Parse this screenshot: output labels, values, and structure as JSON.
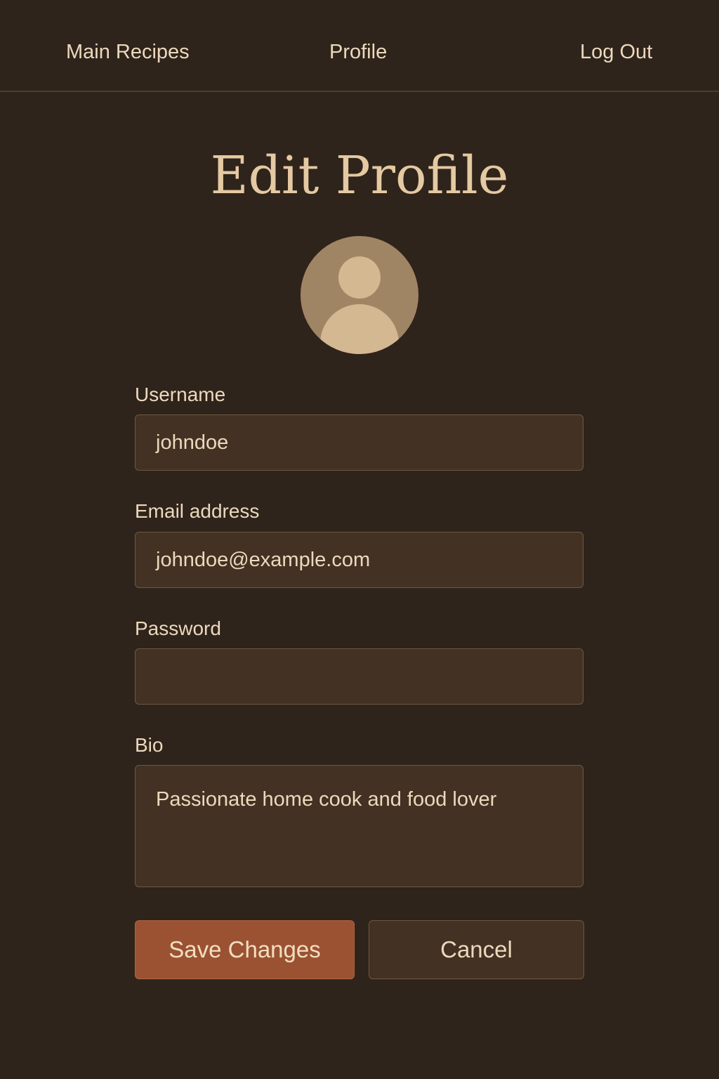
{
  "nav": {
    "items": [
      {
        "label": "Main Recipes"
      },
      {
        "label": "Profile"
      },
      {
        "label": "Log Out"
      }
    ]
  },
  "page": {
    "title": "Edit Profile"
  },
  "avatar": {
    "icon": "user-silhouette-icon"
  },
  "form": {
    "username": {
      "label": "Username",
      "value": "johndoe"
    },
    "email": {
      "label": "Email address",
      "value": "johndoe@example.com"
    },
    "password": {
      "label": "Password",
      "value": ""
    },
    "bio": {
      "label": "Bio",
      "value": "Passionate home cook and food lover"
    }
  },
  "actions": {
    "save_label": "Save Changes",
    "cancel_label": "Cancel"
  },
  "colors": {
    "background": "#2f241b",
    "field_background": "#433123",
    "accent": "#9b5232",
    "title": "#e5c9a2",
    "text": "#ecd9bd"
  }
}
